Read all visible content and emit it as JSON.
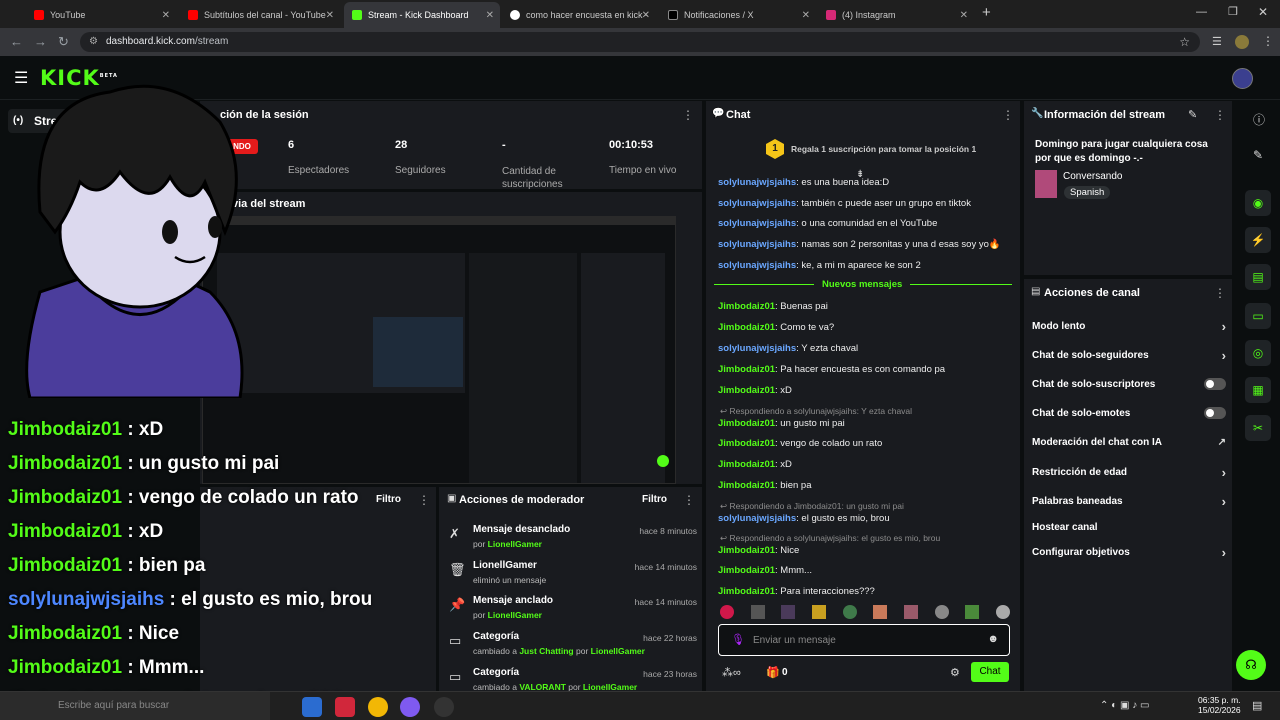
{
  "browser": {
    "tabs": [
      {
        "label": "YouTube"
      },
      {
        "label": "Subtítulos del canal - YouTube"
      },
      {
        "label": "Stream - Kick Dashboard"
      },
      {
        "label": "como hacer encuesta en kick - "
      },
      {
        "label": "Notificaciones / X"
      },
      {
        "label": "(4) Instagram"
      }
    ],
    "url_host": "dashboard.kick.com",
    "url_path": "/stream"
  },
  "kick": {
    "logo": "KICK",
    "beta": "BETA",
    "nav_stream": "Stream"
  },
  "session": {
    "title": "ción de la sesión",
    "live_badge": "NDO",
    "stats": [
      {
        "value": "6",
        "label": "Espectadores"
      },
      {
        "value": "28",
        "label": "Seguidores"
      },
      {
        "value": "-",
        "label": "Cantidad de suscripciones"
      },
      {
        "value": "00:10:53",
        "label": "Tiempo en vivo"
      }
    ],
    "preview_title": "via del stream"
  },
  "overlay_chat": [
    {
      "user": "Jimbodaiz01",
      "text": " : xD",
      "color": "green"
    },
    {
      "user": "Jimbodaiz01",
      "text": " : un gusto mi pai",
      "color": "green"
    },
    {
      "user": "Jimbodaiz01",
      "text": " : vengo de colado un rato",
      "color": "green"
    },
    {
      "user": "Jimbodaiz01",
      "text": " : xD",
      "color": "green"
    },
    {
      "user": "Jimbodaiz01",
      "text": " : bien pa",
      "color": "green"
    },
    {
      "user": "solylunajwjsjaihs",
      "text": " : el gusto es mio, brou",
      "color": "blue"
    },
    {
      "user": "Jimbodaiz01",
      "text": " : Nice",
      "color": "green"
    },
    {
      "user": "Jimbodaiz01",
      "text": " : Mmm...",
      "color": "green"
    },
    {
      "user": "Jimbodaiz01",
      "text": " : Para interacciones???",
      "color": "green"
    }
  ],
  "mod_actions": {
    "title": "Acciones de moderador",
    "filter": "Filtro",
    "filter_left": "Filtro",
    "items": [
      {
        "title": "Mensaje desanclado",
        "sub_prefix": "por ",
        "sub_user": "LionellGamer",
        "sub_suffix": "",
        "time": "hace 8 minutos"
      },
      {
        "title": "LionellGamer",
        "sub_prefix": "eliminó un mensaje",
        "sub_user": "",
        "sub_suffix": "",
        "time": "hace 14 minutos"
      },
      {
        "title": "Mensaje anclado",
        "sub_prefix": "por ",
        "sub_user": "LionellGamer",
        "sub_suffix": "",
        "time": "hace 14 minutos"
      },
      {
        "title": "Categoría",
        "sub_prefix": "cambiado a ",
        "sub_user": "Just Chatting",
        "sub_mid": " por ",
        "sub_user2": "LionellGamer",
        "time": "hace 22 horas"
      },
      {
        "title": "Categoría",
        "sub_prefix": "cambiado a ",
        "sub_user": "VALORANT",
        "sub_mid": " por ",
        "sub_user2": "LionellGamer",
        "time": "hace 23 horas"
      }
    ]
  },
  "chat": {
    "title": "Chat",
    "pinned_rank": "1",
    "pinned_text": "Regala 1 suscripción para tomar la posición 1",
    "new_messages": "Nuevos mensajes",
    "messages_before": [
      {
        "user": "solylunajwjsjaihs",
        "text": ": es una buena idea:D"
      },
      {
        "user": "solylunajwjsjaihs",
        "text": ": también c puede aser un grupo en tiktok"
      },
      {
        "user": "solylunajwjsjaihs",
        "text": ": o una comunidad en el YouTube"
      },
      {
        "user": "solylunajwjsjaihs",
        "text": ": namas son 2 personitas y una d esas soy yo🔥"
      },
      {
        "user": "solylunajwjsjaihs",
        "text": ": ke, a mi m aparece ke son 2"
      }
    ],
    "messages_after": [
      {
        "user": "Jimbodaiz01",
        "text": ": Buenas pai",
        "color": "green"
      },
      {
        "user": "Jimbodaiz01",
        "text": ": Como te va?",
        "color": "green"
      },
      {
        "user": "solylunajwjsjaihs",
        "text": ": Y ezta chaval",
        "color": "blue"
      },
      {
        "user": "Jimbodaiz01",
        "text": ": Pa hacer encuesta es con comando pa",
        "color": "green"
      },
      {
        "user": "Jimbodaiz01",
        "text": ": xD",
        "color": "green"
      },
      {
        "reply": "Respondiendo a solylunajwjsjaihs: Y ezta chaval",
        "user": "Jimbodaiz01",
        "text": ": un gusto mi pai",
        "color": "green"
      },
      {
        "user": "Jimbodaiz01",
        "text": ": vengo de colado un rato",
        "color": "green"
      },
      {
        "user": "Jimbodaiz01",
        "text": ": xD",
        "color": "green"
      },
      {
        "user": "Jimbodaiz01",
        "text": ": bien pa",
        "color": "green"
      },
      {
        "reply": "Respondiendo a Jimbodaiz01: un gusto mi pai",
        "user": "solylunajwjsjaihs",
        "text": ": el gusto es mio, brou",
        "color": "blue"
      },
      {
        "reply": "Respondiendo a solylunajwjsjaihs: el gusto es mio, brou",
        "user": "Jimbodaiz01",
        "text": ": Nice",
        "color": "green"
      },
      {
        "user": "Jimbodaiz01",
        "text": ": Mmm...",
        "color": "green"
      },
      {
        "user": "Jimbodaiz01",
        "text": ": Para interacciones???",
        "color": "green"
      }
    ],
    "input_placeholder": "Enviar un mensaje",
    "points": "0",
    "send_label": "Chat"
  },
  "stream_info": {
    "title": "Información del stream",
    "stream_title": "Domingo para jugar cualquiera cosa por que es domingo -.-",
    "category": "Conversando",
    "language": "Spanish"
  },
  "channel_actions": {
    "title": "Acciones de canal",
    "items": [
      {
        "label": "Modo lento",
        "kind": "chevron"
      },
      {
        "label": "Chat de solo-seguidores",
        "kind": "chevron"
      },
      {
        "label": "Chat de solo-suscriptores",
        "kind": "toggle"
      },
      {
        "label": "Chat de solo-emotes",
        "kind": "toggle"
      },
      {
        "label": "Moderación del chat con IA",
        "kind": "external"
      },
      {
        "label": "Restricción de edad",
        "kind": "chevron"
      },
      {
        "label": "Palabras baneadas",
        "kind": "chevron"
      },
      {
        "label": "Hostear canal",
        "kind": "none"
      },
      {
        "label": "Configurar objetivos",
        "kind": "chevron"
      }
    ]
  },
  "taskbar": {
    "search_placeholder": "Escribe aquí para buscar",
    "time": "06:35 p. m.",
    "date": "15/02/2026"
  },
  "colors": {
    "accent": "#53fc18",
    "blue_user": "#4d87ff"
  }
}
